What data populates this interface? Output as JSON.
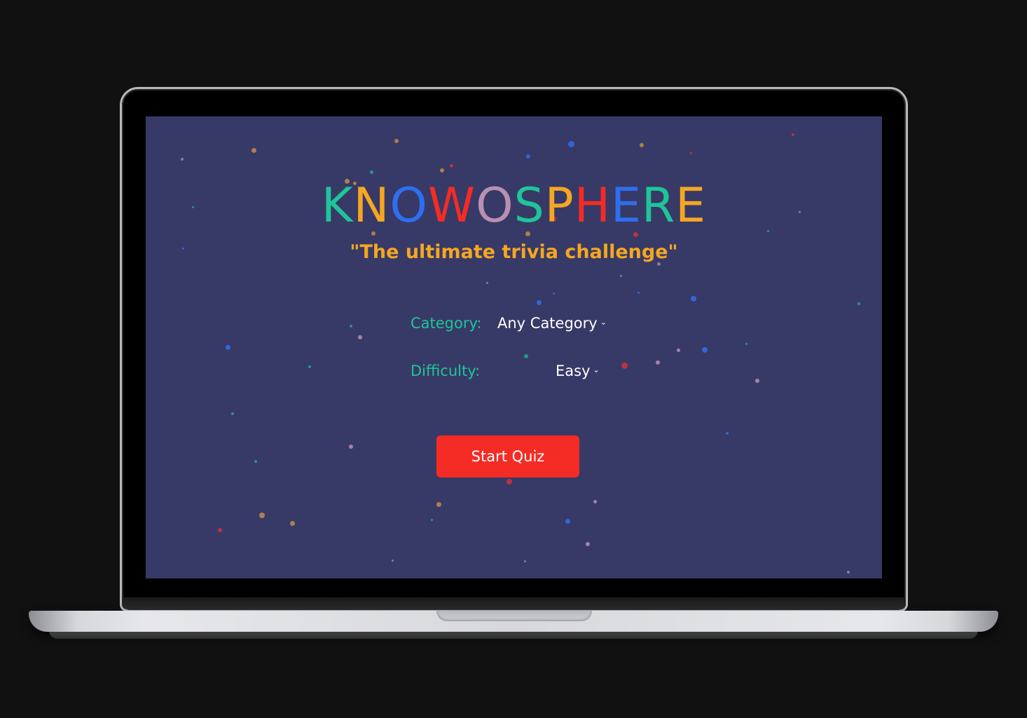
{
  "app": {
    "title_letters": [
      {
        "char": "K",
        "color": "#1fc59a"
      },
      {
        "char": "N",
        "color": "#f5a623"
      },
      {
        "char": "O",
        "color": "#2e6ef0"
      },
      {
        "char": "W",
        "color": "#f52b25"
      },
      {
        "char": "O",
        "color": "#b98fb2"
      },
      {
        "char": "S",
        "color": "#1fc59a"
      },
      {
        "char": "P",
        "color": "#f5a623"
      },
      {
        "char": "H",
        "color": "#f52b25"
      },
      {
        "char": "E",
        "color": "#2e6ef0"
      },
      {
        "char": "R",
        "color": "#1fc59a"
      },
      {
        "char": "E",
        "color": "#f5a623"
      }
    ],
    "tagline": "\"The ultimate trivia challenge\"",
    "tagline_color": "#f5a623"
  },
  "form": {
    "label_color": "#1fc59a",
    "category_label": "Category:",
    "category_value": "Any Category",
    "difficulty_label": "Difficulty:",
    "difficulty_value": "Easy",
    "dropdown_icon": "chevron-down-icon"
  },
  "actions": {
    "start_label": "Start Quiz",
    "start_color": "#f52b25"
  },
  "theme": {
    "screen_bg": "#373a66",
    "page_bg": "#111111",
    "confetti_colors": [
      "#c48a4a",
      "#2e6ef0",
      "#1fa98a",
      "#b98fb2",
      "#d0333a",
      "#8e8fa8"
    ]
  }
}
